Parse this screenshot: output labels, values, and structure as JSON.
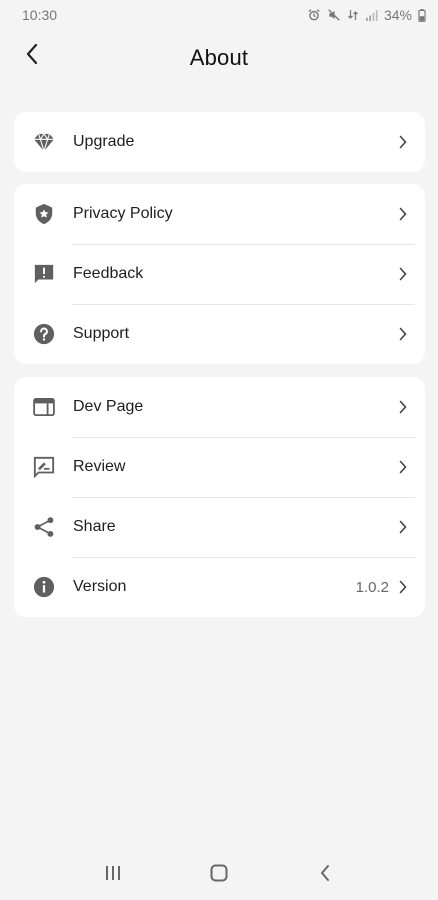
{
  "status_bar": {
    "time": "10:30",
    "battery": "34%",
    "icons": [
      "alarm-icon",
      "mute-icon",
      "data-icon",
      "signal-icon",
      "battery-icon"
    ]
  },
  "header": {
    "title": "About",
    "back_icon": "back-arrow-icon"
  },
  "groups": [
    {
      "items": [
        {
          "label": "Upgrade",
          "icon": "diamond-icon"
        }
      ]
    },
    {
      "items": [
        {
          "label": "Privacy Policy",
          "icon": "shield-icon"
        },
        {
          "label": "Feedback",
          "icon": "feedback-icon"
        },
        {
          "label": "Support",
          "icon": "help-icon"
        }
      ]
    },
    {
      "items": [
        {
          "label": "Dev Page",
          "icon": "web-page-icon"
        },
        {
          "label": "Review",
          "icon": "rate-review-icon"
        },
        {
          "label": "Share",
          "icon": "share-icon"
        },
        {
          "label": "Version",
          "icon": "info-icon",
          "value": "1.0.2"
        }
      ]
    }
  ],
  "nav_bar": {
    "icons": [
      "recents-icon",
      "home-icon",
      "back-icon"
    ]
  },
  "colors": {
    "background": "#f4f4f4",
    "card": "#ffffff",
    "icon": "#5f5f5f",
    "text": "#1e1e1e"
  }
}
